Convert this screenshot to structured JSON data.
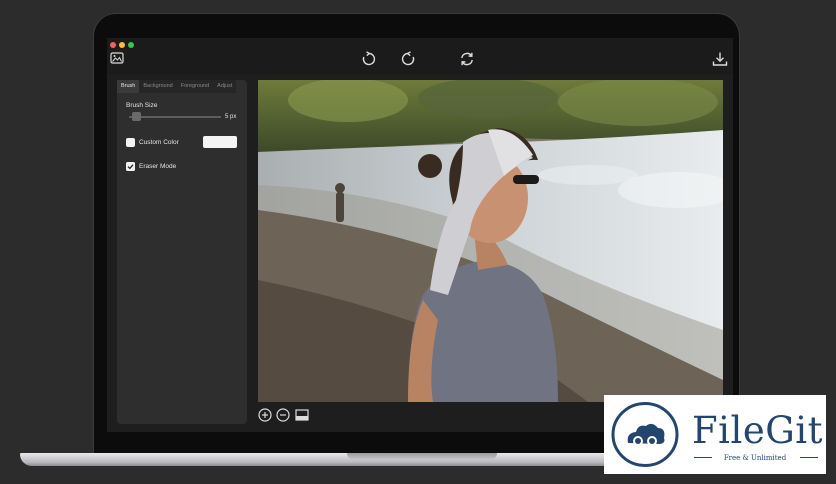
{
  "sidebar": {
    "tabs": [
      {
        "label": "Brush",
        "active": true
      },
      {
        "label": "Background",
        "active": false
      },
      {
        "label": "Foreground",
        "active": false
      },
      {
        "label": "Adjust",
        "active": false
      }
    ],
    "brush_size_label": "Brush Size",
    "brush_size_value": "5 px",
    "brush_size_fraction": 0.05,
    "custom_color_label": "Custom Color",
    "custom_color_checked": false,
    "custom_color_value": "#f4f4f4",
    "eraser_mode_label": "Eraser Mode",
    "eraser_mode_checked": true
  },
  "toolbar": {
    "icons": [
      "image-icon",
      "rotate-right-icon",
      "rotate-left-icon",
      "refresh-icon",
      "download-icon"
    ]
  },
  "bottom_tools": {
    "icons": [
      "zoom-in-icon",
      "zoom-out-icon",
      "fit-screen-icon"
    ]
  },
  "watermark": {
    "title": "FileGit",
    "tagline": "Free & Unlimited",
    "brand_color": "#24466e"
  }
}
